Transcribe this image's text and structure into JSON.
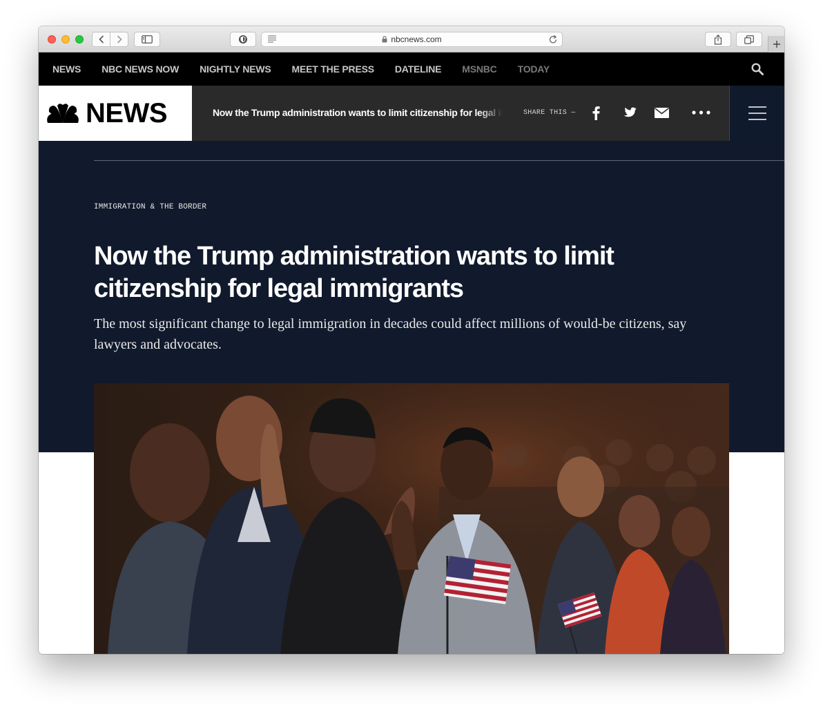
{
  "browser": {
    "url": "nbcnews.com"
  },
  "topnav": {
    "items": [
      "NEWS",
      "NBC NEWS NOW",
      "NIGHTLY NEWS",
      "MEET THE PRESS",
      "DATELINE",
      "MSNBC",
      "TODAY"
    ]
  },
  "sticky": {
    "logo_text": "NEWS",
    "headline": "Now the Trump administration wants to limit citizenship for legal immigrants",
    "share_label": "SHARE THIS —"
  },
  "article": {
    "eyebrow": "IMMIGRATION & THE BORDER",
    "headline": "Now the Trump administration wants to limit citizenship for legal immigrants",
    "dek": "The most significant change to legal immigration in decades could affect millions of would-be citizens, say lawyers and advocates."
  },
  "colors": {
    "hero_bg": "#111a2c",
    "topnav_bg": "#000000",
    "sticky_bg": "#2a2a2a"
  },
  "icons": [
    "back-icon",
    "forward-icon",
    "sidebar-icon",
    "privacy-icon",
    "reader-icon",
    "lock-icon",
    "reload-icon",
    "share-icon",
    "tabs-icon",
    "new-tab-icon",
    "search-icon",
    "peacock-logo-icon",
    "facebook-icon",
    "twitter-icon",
    "email-icon",
    "more-icon",
    "hamburger-icon"
  ]
}
